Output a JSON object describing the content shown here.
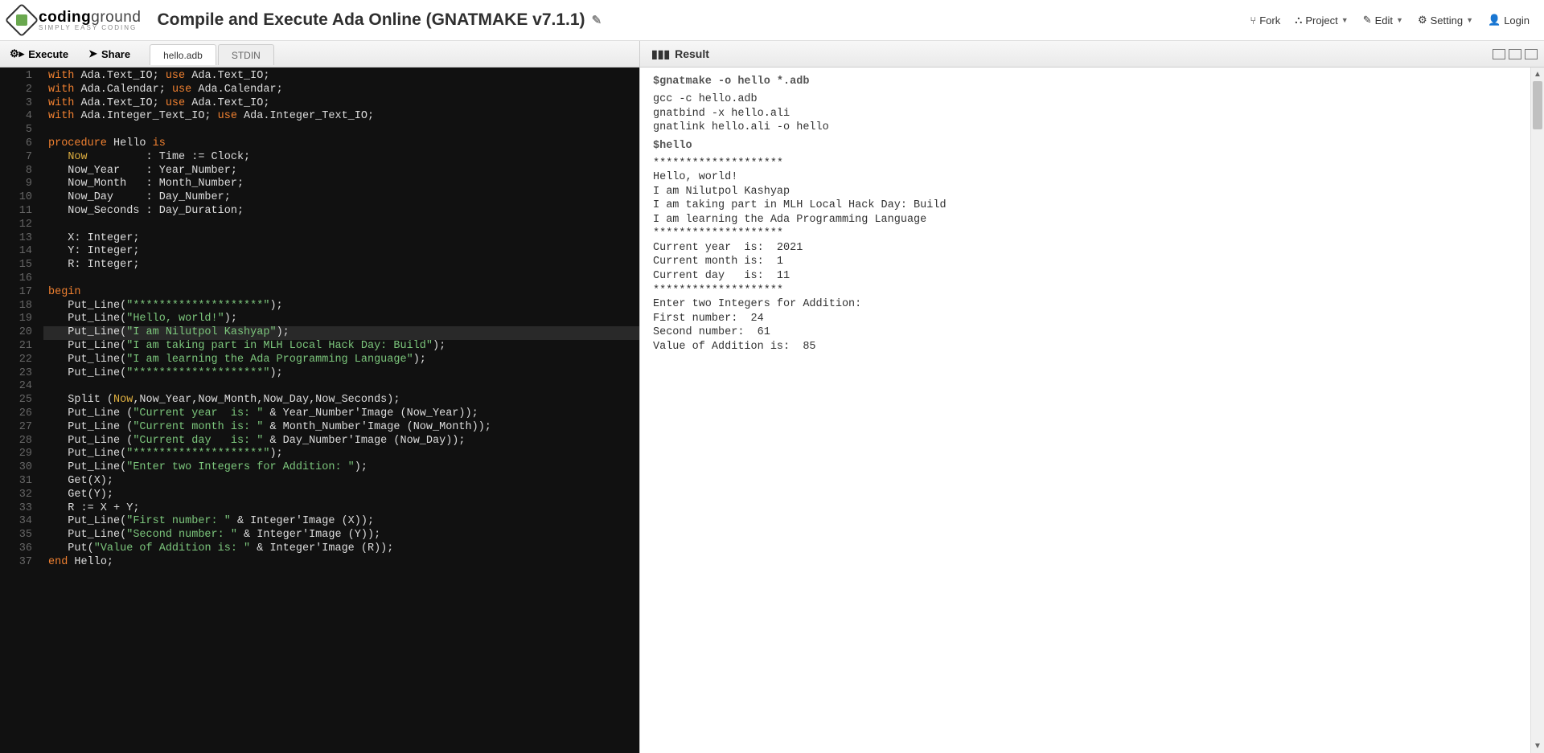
{
  "header": {
    "logo_main": "codingground",
    "logo_sub": "SIMPLY  EASY  CODING",
    "title": "Compile and Execute Ada Online (GNATMAKE v7.1.1)",
    "menu": {
      "fork": "Fork",
      "project": "Project",
      "edit": "Edit",
      "setting": "Setting",
      "login": "Login"
    }
  },
  "toolbar": {
    "execute_label": "Execute",
    "share_label": "Share",
    "tabs": [
      "hello.adb",
      "STDIN"
    ],
    "result_label": "Result"
  },
  "code_lines": [
    {
      "n": 1,
      "t": "with",
      "rest": [
        [
          "kw",
          "with"
        ],
        [
          "op",
          " Ada.Text_IO; "
        ],
        [
          "kw",
          "use"
        ],
        [
          "op",
          " Ada.Text_IO;"
        ]
      ]
    },
    {
      "n": 2,
      "rest": [
        [
          "kw",
          "with"
        ],
        [
          "op",
          " Ada.Calendar; "
        ],
        [
          "kw",
          "use"
        ],
        [
          "op",
          " Ada.Calendar;"
        ]
      ]
    },
    {
      "n": 3,
      "rest": [
        [
          "kw",
          "with"
        ],
        [
          "op",
          " Ada.Text_IO; "
        ],
        [
          "kw",
          "use"
        ],
        [
          "op",
          " Ada.Text_IO;"
        ]
      ]
    },
    {
      "n": 4,
      "rest": [
        [
          "kw",
          "with"
        ],
        [
          "op",
          " Ada.Integer_Text_IO; "
        ],
        [
          "kw",
          "use"
        ],
        [
          "op",
          " Ada.Integer_Text_IO;"
        ]
      ]
    },
    {
      "n": 5,
      "rest": []
    },
    {
      "n": 6,
      "rest": [
        [
          "kw",
          "procedure"
        ],
        [
          "id",
          " Hello "
        ],
        [
          "kw",
          "is"
        ]
      ]
    },
    {
      "n": 7,
      "rest": [
        [
          "op",
          "   "
        ],
        [
          "now",
          "Now"
        ],
        [
          "op",
          "         : Time := Clock;"
        ]
      ]
    },
    {
      "n": 8,
      "rest": [
        [
          "op",
          "   Now_Year    : Year_Number;"
        ]
      ]
    },
    {
      "n": 9,
      "rest": [
        [
          "op",
          "   Now_Month   : Month_Number;"
        ]
      ]
    },
    {
      "n": 10,
      "rest": [
        [
          "op",
          "   Now_Day     : Day_Number;"
        ]
      ]
    },
    {
      "n": 11,
      "rest": [
        [
          "op",
          "   Now_Seconds : Day_Duration;"
        ]
      ]
    },
    {
      "n": 12,
      "rest": []
    },
    {
      "n": 13,
      "rest": [
        [
          "op",
          "   X: Integer;"
        ]
      ]
    },
    {
      "n": 14,
      "rest": [
        [
          "op",
          "   Y: Integer;"
        ]
      ]
    },
    {
      "n": 15,
      "rest": [
        [
          "op",
          "   R: Integer;"
        ]
      ]
    },
    {
      "n": 16,
      "rest": []
    },
    {
      "n": 17,
      "rest": [
        [
          "kw",
          "begin"
        ]
      ]
    },
    {
      "n": 18,
      "rest": [
        [
          "op",
          "   Put_Line("
        ],
        [
          "str",
          "\"********************\""
        ],
        [
          "op",
          ");"
        ]
      ]
    },
    {
      "n": 19,
      "rest": [
        [
          "op",
          "   Put_Line("
        ],
        [
          "str",
          "\"Hello, world!\""
        ],
        [
          "op",
          ");"
        ]
      ]
    },
    {
      "n": 20,
      "rest": [
        [
          "op",
          "   Put_Line("
        ],
        [
          "str",
          "\"I am Nilutpol Kashyap\""
        ],
        [
          "op",
          ");"
        ]
      ]
    },
    {
      "n": 21,
      "rest": [
        [
          "op",
          "   Put_Line("
        ],
        [
          "str",
          "\"I am taking part in MLH Local Hack Day: Build\""
        ],
        [
          "op",
          ");"
        ]
      ]
    },
    {
      "n": 22,
      "rest": [
        [
          "op",
          "   Put_line("
        ],
        [
          "str",
          "\"I am learning the Ada Programming Language\""
        ],
        [
          "op",
          ");"
        ]
      ]
    },
    {
      "n": 23,
      "rest": [
        [
          "op",
          "   Put_Line("
        ],
        [
          "str",
          "\"********************\""
        ],
        [
          "op",
          ");"
        ]
      ]
    },
    {
      "n": 24,
      "rest": []
    },
    {
      "n": 25,
      "rest": [
        [
          "op",
          "   Split ("
        ],
        [
          "now",
          "Now"
        ],
        [
          "op",
          ",Now_Year,Now_Month,Now_Day,Now_Seconds);"
        ]
      ]
    },
    {
      "n": 26,
      "rest": [
        [
          "op",
          "   Put_Line ("
        ],
        [
          "str",
          "\"Current year  is: \""
        ],
        [
          "op",
          " & Year_Number'Image (Now_Year));"
        ]
      ]
    },
    {
      "n": 27,
      "rest": [
        [
          "op",
          "   Put_Line ("
        ],
        [
          "str",
          "\"Current month is: \""
        ],
        [
          "op",
          " & Month_Number'Image (Now_Month));"
        ]
      ]
    },
    {
      "n": 28,
      "rest": [
        [
          "op",
          "   Put_Line ("
        ],
        [
          "str",
          "\"Current day   is: \""
        ],
        [
          "op",
          " & Day_Number'Image (Now_Day));"
        ]
      ]
    },
    {
      "n": 29,
      "rest": [
        [
          "op",
          "   Put_Line("
        ],
        [
          "str",
          "\"********************\""
        ],
        [
          "op",
          ");"
        ]
      ]
    },
    {
      "n": 30,
      "rest": [
        [
          "op",
          "   Put_Line("
        ],
        [
          "str",
          "\"Enter two Integers for Addition: \""
        ],
        [
          "op",
          ");"
        ]
      ]
    },
    {
      "n": 31,
      "rest": [
        [
          "op",
          "   Get(X);"
        ]
      ]
    },
    {
      "n": 32,
      "rest": [
        [
          "op",
          "   Get(Y);"
        ]
      ]
    },
    {
      "n": 33,
      "rest": [
        [
          "op",
          "   R := X + Y;"
        ]
      ]
    },
    {
      "n": 34,
      "rest": [
        [
          "op",
          "   Put_Line("
        ],
        [
          "str",
          "\"First number: \""
        ],
        [
          "op",
          " & Integer'Image (X));"
        ]
      ]
    },
    {
      "n": 35,
      "rest": [
        [
          "op",
          "   Put_Line("
        ],
        [
          "str",
          "\"Second number: \""
        ],
        [
          "op",
          " & Integer'Image (Y));"
        ]
      ]
    },
    {
      "n": 36,
      "rest": [
        [
          "op",
          "   Put("
        ],
        [
          "str",
          "\"Value of Addition is: \""
        ],
        [
          "op",
          " & Integer'Image (R));"
        ]
      ]
    },
    {
      "n": 37,
      "rest": [
        [
          "kw",
          "end"
        ],
        [
          "op",
          " Hello;"
        ]
      ]
    }
  ],
  "highlighted_line": 20,
  "result": {
    "cmd1": "$gnatmake -o hello *.adb",
    "compile": "gcc -c hello.adb\ngnatbind -x hello.ali\ngnatlink hello.ali -o hello",
    "cmd2": "$hello",
    "output": "********************\nHello, world!\nI am Nilutpol Kashyap\nI am taking part in MLH Local Hack Day: Build\nI am learning the Ada Programming Language\n********************\nCurrent year  is:  2021\nCurrent month is:  1\nCurrent day   is:  11\n********************\nEnter two Integers for Addition:\nFirst number:  24\nSecond number:  61\nValue of Addition is:  85"
  }
}
